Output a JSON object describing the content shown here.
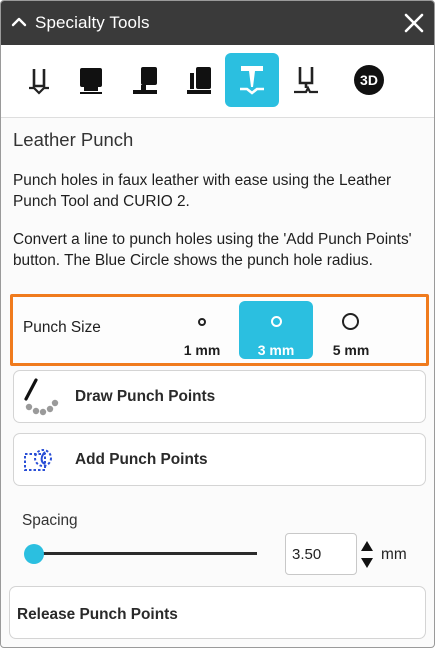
{
  "window": {
    "title": "Specialty Tools"
  },
  "toolbar": {
    "tools": [
      {
        "icon": "embosser-tool-icon",
        "active": false
      },
      {
        "icon": "deboss-tool-icon",
        "active": false
      },
      {
        "icon": "stipple-tool-icon",
        "active": false
      },
      {
        "icon": "etch-tool-icon",
        "active": false
      },
      {
        "icon": "leather-punch-tool-icon",
        "active": true
      },
      {
        "icon": "pen-holder-tool-icon",
        "active": false
      },
      {
        "icon": "3d-tool-icon",
        "active": false,
        "badge": "3D"
      }
    ]
  },
  "tool": {
    "heading": "Leather Punch",
    "description": "Punch holes in faux leather with ease using the Leather Punch Tool and CURIO 2.",
    "instructions": "Convert a line to punch holes using the 'Add Punch Points' button. The Blue Circle shows the punch hole radius."
  },
  "punch_size": {
    "label": "Punch Size",
    "options": [
      {
        "label": "1 mm",
        "selected": false
      },
      {
        "label": "3 mm",
        "selected": true
      },
      {
        "label": "5 mm",
        "selected": false
      }
    ]
  },
  "actions": {
    "draw": "Draw Punch Points",
    "add": "Add Punch Points",
    "release": "Release Punch Points"
  },
  "spacing": {
    "label": "Spacing",
    "value": "3.50",
    "unit": "mm",
    "slider_fraction": 0.02
  },
  "colors": {
    "accent": "#2bbfe0",
    "highlight": "#f07b1d",
    "titlebar": "#3a3a3a"
  }
}
